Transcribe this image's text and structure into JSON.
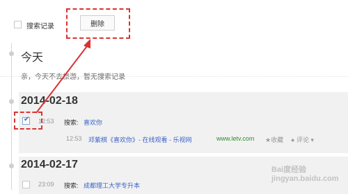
{
  "top_bar": {
    "search_record_label": "搜索记录",
    "delete_button_label": "删除"
  },
  "today": {
    "heading": "今天",
    "message": "亲，今天不去旅游，暂无搜索记录"
  },
  "groups": [
    {
      "date": "2014-02-18",
      "search_time": "12:53",
      "search_prefix": "搜索:",
      "search_term": "喜欢你",
      "result_time": "12:53",
      "result_title": "邓紫棋《喜欢你》- 在线观看 - 乐视网",
      "result_url": "www.letv.com",
      "actions": [
        "★收藏",
        "评论"
      ],
      "checked": true
    },
    {
      "date": "2014-02-17",
      "search_time": "23:09",
      "search_prefix": "搜索:",
      "search_term": "成都理工大学专升本",
      "checked": false
    }
  ],
  "watermark": "Bai度经验 jingyan.baidu.com",
  "colors": {
    "accent_red": "#d93232",
    "link_blue": "#3b63c7",
    "url_green": "#2f8a2f"
  }
}
